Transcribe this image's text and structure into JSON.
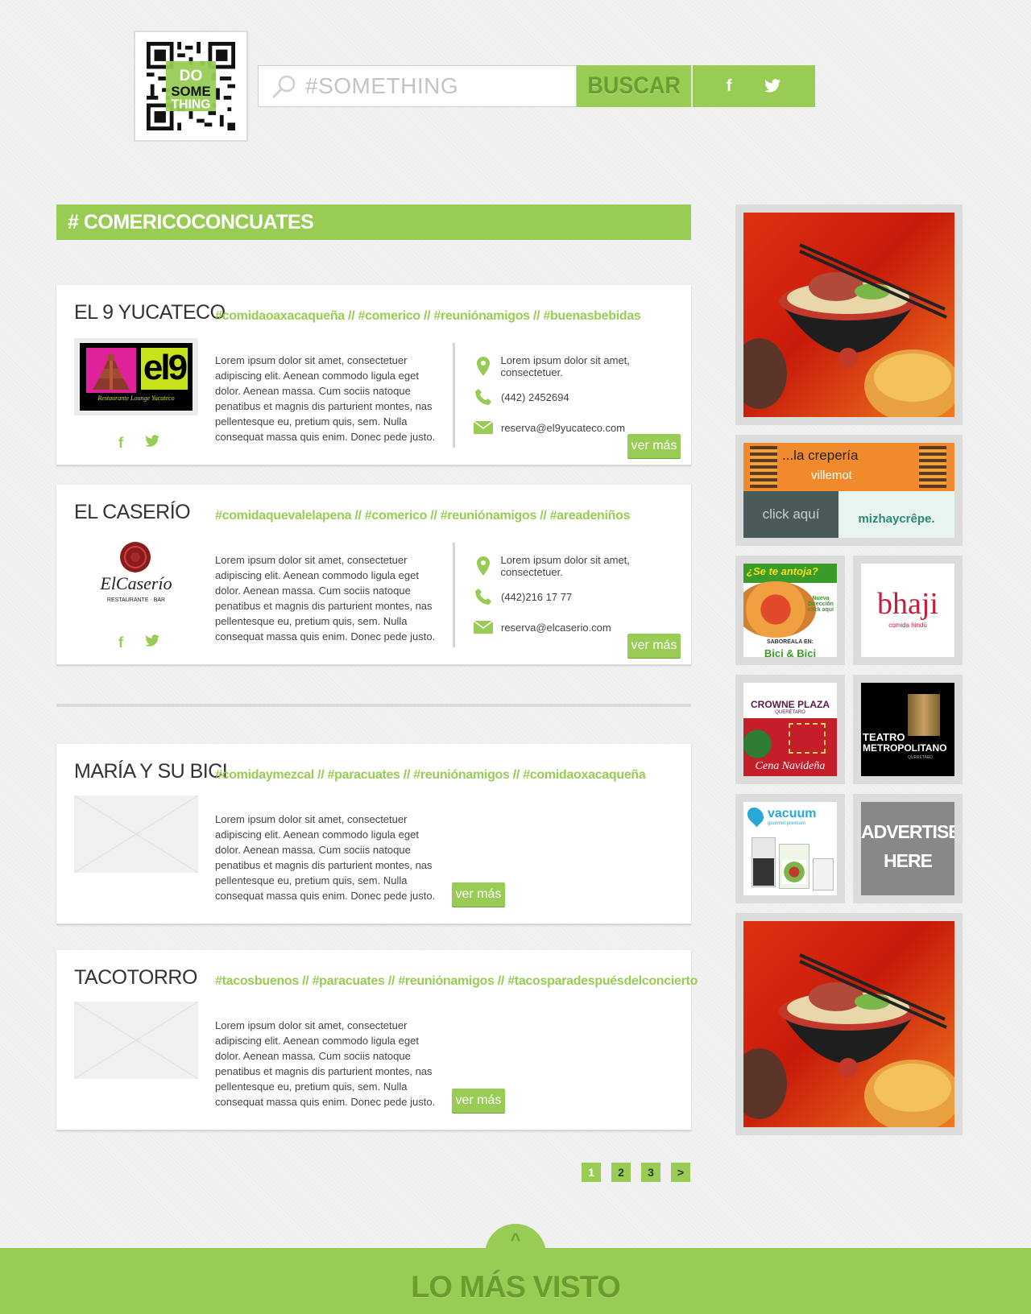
{
  "header": {
    "qr_logo_text": "DO SOME THING",
    "search": {
      "placeholder": "#SOMETHING"
    },
    "search_button": "BUSCAR",
    "social": {
      "facebook": "f",
      "twitter": "t"
    }
  },
  "section": {
    "title": "# COMERICOCONCUATES"
  },
  "listings": [
    {
      "name": "EL 9 YUCATECO",
      "tags": "#comidaoaxacaqueña // #comerico // #reuniónamigos // #buenasbebidas",
      "logo_text": "el9",
      "logo_subtext": "Restaurante Lounge Yucateco",
      "description": "Lorem ipsum dolor sit amet, consectetuer adipiscing elit. Aenean commodo ligula eget dolor. Aenean massa. Cum sociis natoque penatibus et magnis dis parturient montes, nas pellentesque eu, pretium quis, sem. Nulla consequat massa quis enim. Donec pede justo.",
      "address": "Lorem ipsum dolor sit amet, consectetuer.",
      "phone": "(442) 2452694",
      "email": "reserva@el9yucateco.com",
      "more": "ver más"
    },
    {
      "name": "EL CASERÍO",
      "tags": "#comidaquevalelapena // #comerico // #reuniónamigos // #areadeniños",
      "logo_text": "ElCaserío",
      "logo_subtext": "RESTAURANTE · BAR",
      "description": "Lorem ipsum dolor sit amet, consectetuer adipiscing elit. Aenean commodo ligula eget dolor. Aenean massa. Cum sociis natoque penatibus et magnis dis parturient montes, nas pellentesque eu, pretium quis, sem. Nulla consequat massa quis enim. Donec pede justo.",
      "address": "Lorem ipsum dolor sit amet, consectetuer.",
      "phone": "(442)216 17 77",
      "email": "reserva@elcaserio.com",
      "more": "ver más"
    },
    {
      "name": "MARÍA Y SU BICI",
      "tags": "#comidaymezcal  // #paracuates // #reuniónamigos // #comidaoxacaqueña",
      "description": "Lorem ipsum dolor sit amet, consectetuer adipiscing elit. Aenean commodo ligula eget dolor. Aenean massa. Cum sociis natoque penatibus et magnis dis parturient montes, nas pellentesque eu, pretium quis, sem. Nulla consequat massa quis enim. Donec pede justo.",
      "more": "ver más"
    },
    {
      "name": "TACOTORRO",
      "tags": "#tacosbuenos  // #paracuates // #reuniónamigos //  #tacosparadespuésdelconcierto",
      "description": "Lorem ipsum dolor sit amet, consectetuer adipiscing elit. Aenean commodo ligula eget dolor. Aenean massa. Cum sociis natoque penatibus et magnis dis parturient montes, nas pellentesque eu, pretium quis, sem. Nulla consequat massa quis enim. Donec pede justo.",
      "more": "ver más"
    }
  ],
  "pagination": {
    "pages": [
      "1",
      "2",
      "3"
    ],
    "next": ">",
    "current": "1"
  },
  "ads": {
    "creperia": {
      "line1": "...la crepería",
      "line2": "villemot",
      "cta": "click aquí",
      "brand": "mizhaycrêpe."
    },
    "pizza": {
      "headline": "¿Se te antoja?",
      "note": "Nueva Dirección click aquí",
      "tag": "SABOREALA EN:",
      "brand": "Bici & Bici"
    },
    "bhaji": {
      "brand": "bhaji",
      "subtitle": "comida hindú"
    },
    "crowne": {
      "brand": "CROWNE PLAZA",
      "city": "QUERÉTARO",
      "caption": "Cena Navideña"
    },
    "teatro": {
      "line1": "TEATRO",
      "line2": "METROPOLITANO",
      "city": "QUERÉTARO"
    },
    "vacuum": {
      "brand": "vacuum",
      "subtitle": "gourmet premium"
    },
    "advertise": {
      "line1": "ADVERTISE",
      "line2": "HERE"
    }
  },
  "footer": {
    "arrow": "^",
    "title": "LO MÁS VISTO"
  },
  "colors": {
    "accent": "#98cc55",
    "accent_dark": "#6a9d2d",
    "background": "#f1f1f1"
  },
  "icons": [
    "search-icon",
    "facebook-icon",
    "twitter-icon",
    "location-pin-icon",
    "phone-icon",
    "envelope-icon"
  ]
}
